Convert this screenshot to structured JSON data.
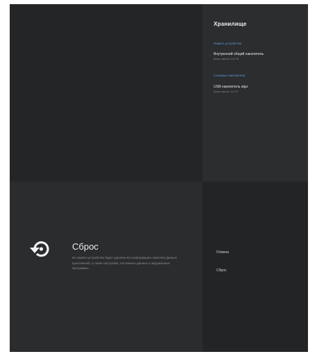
{
  "storage": {
    "title": "Хранилище",
    "device_memory_header": "Память устройства",
    "internal": {
      "name": "Внутренний общий накопитель",
      "free": "Всего места: 3.6 Гб"
    },
    "removable_header": "Съемные накопители",
    "usb": {
      "name": "USB-накопитель aigo",
      "free": "Всего места: 31 Гб"
    }
  },
  "reset": {
    "icon": "restore-icon",
    "title": "Сброс",
    "description": "Из памяти устройства будет удалена вся информация, включая данные приложений, а также настройки, системные данные и загруженные программы.",
    "actions": {
      "cancel": "Отмена",
      "reset": "Сброс"
    }
  },
  "colors": {
    "accent": "#5b9bd5",
    "background": "#222426",
    "panel": "#2b2d2f"
  }
}
